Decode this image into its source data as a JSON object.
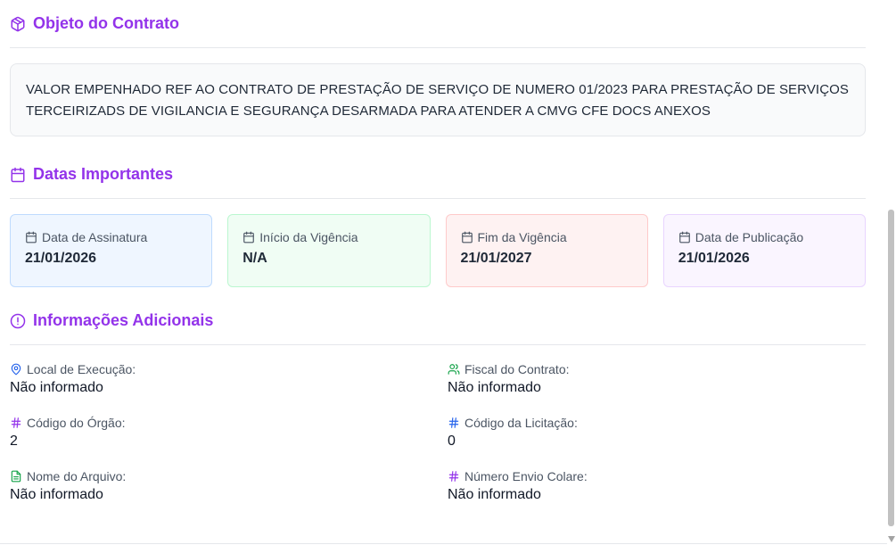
{
  "objeto": {
    "title": "Objeto do Contrato",
    "icon": "package-icon",
    "text": "VALOR EMPENHADO REF AO CONTRATO DE PRESTAÇÃO DE SERVIÇO DE NUMERO 01/2023 PARA PRESTAÇÃO DE SERVIÇOS TERCEIRIZADS DE VIGILANCIA E SEGURANÇA DESARMADA PARA ATENDER A CMVG CFE DOCS ANEXOS"
  },
  "datas": {
    "title": "Datas Importantes",
    "icon": "calendar-icon",
    "cards": [
      {
        "label": "Data de Assinatura",
        "value": "21/01/2026",
        "color": "#eff6ff"
      },
      {
        "label": "Início da Vigência",
        "value": "N/A",
        "color": "#f0fdf4"
      },
      {
        "label": "Fim da Vigência",
        "value": "21/01/2027",
        "color": "#fef2f2"
      },
      {
        "label": "Data de Publicação",
        "value": "21/01/2026",
        "color": "#faf5ff"
      }
    ]
  },
  "info": {
    "title": "Informações Adicionais",
    "icon": "alert-circle-icon",
    "items": [
      {
        "label": "Local de Execução:",
        "value": "Não informado",
        "icon": "map-pin-icon",
        "icon_color": "#2563eb"
      },
      {
        "label": "Fiscal do Contrato:",
        "value": "Não informado",
        "icon": "users-icon",
        "icon_color": "#16a34a"
      },
      {
        "label": "Código do Órgão:",
        "value": "2",
        "icon": "hash-icon",
        "icon_color": "#9333ea"
      },
      {
        "label": "Código da Licitação:",
        "value": "0",
        "icon": "hash-icon",
        "icon_color": "#2563eb"
      },
      {
        "label": "Nome do Arquivo:",
        "value": "Não informado",
        "icon": "file-text-icon",
        "icon_color": "#16a34a"
      },
      {
        "label": "Número Envio Colare:",
        "value": "Não informado",
        "icon": "hash-icon",
        "icon_color": "#9333ea"
      }
    ]
  },
  "colors": {
    "accent": "#9333ea"
  }
}
